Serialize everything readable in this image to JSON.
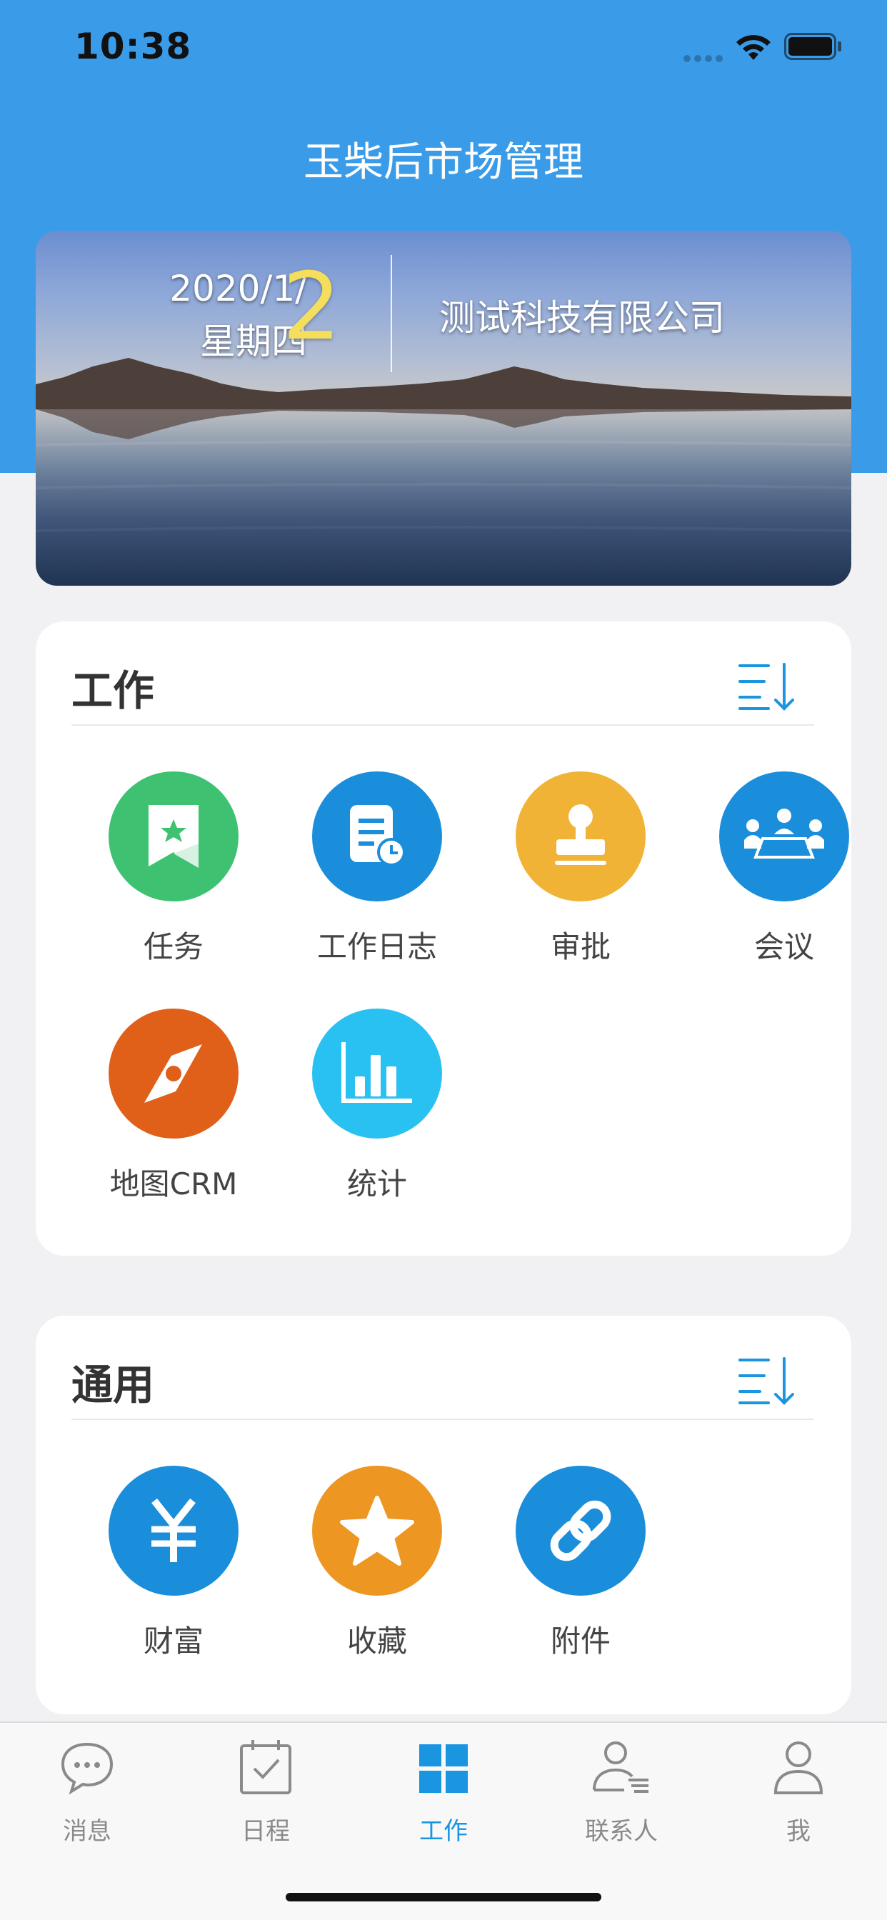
{
  "status_bar": {
    "time": "10:38"
  },
  "app_title": "玉柴后市场管理",
  "banner": {
    "date_line": "2020/1/",
    "weekday": "星期四",
    "day": "2",
    "company": "测试科技有限公司"
  },
  "work_section": {
    "title": "工作",
    "items": [
      {
        "label": "任务",
        "icon": "task-bookmark-icon",
        "color": "#3ec272"
      },
      {
        "label": "工作日志",
        "icon": "work-log-icon",
        "color": "#1a8edb"
      },
      {
        "label": "审批",
        "icon": "approval-stamp-icon",
        "color": "#f0b335"
      },
      {
        "label": "会议",
        "icon": "meeting-icon",
        "color": "#1a8edb"
      },
      {
        "label": "地图CRM",
        "icon": "map-compass-icon",
        "color": "#e0601a"
      },
      {
        "label": "统计",
        "icon": "statistics-chart-icon",
        "color": "#29c0f2"
      }
    ]
  },
  "general_section": {
    "title": "通用",
    "items": [
      {
        "label": "财富",
        "icon": "wealth-yen-icon",
        "color": "#1a8edb"
      },
      {
        "label": "收藏",
        "icon": "favorite-star-icon",
        "color": "#ee9622"
      },
      {
        "label": "附件",
        "icon": "attachment-link-icon",
        "color": "#1a8edb"
      }
    ]
  },
  "tab_bar": {
    "items": [
      {
        "label": "消息",
        "icon": "message-bubble-icon",
        "active": false
      },
      {
        "label": "日程",
        "icon": "calendar-check-icon",
        "active": false
      },
      {
        "label": "工作",
        "icon": "work-grid-icon",
        "active": true
      },
      {
        "label": "联系人",
        "icon": "contacts-icon",
        "active": false
      },
      {
        "label": "我",
        "icon": "profile-icon",
        "active": false
      }
    ]
  },
  "colors": {
    "header_blue": "#3a9ce8",
    "accent": "#1a95e0",
    "date_day": "#f5de5c"
  }
}
